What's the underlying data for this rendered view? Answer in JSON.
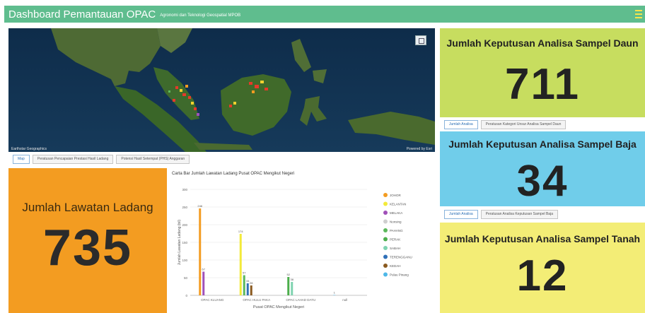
{
  "header": {
    "title": "Dashboard Pemantauan OPAC",
    "subtitle": "Agronomi dan Teknologi Geospatial MPOB"
  },
  "map": {
    "attribution": "Earthstar Geographics",
    "powered_by": "Powered by Esri",
    "tabs": [
      {
        "label": "Map",
        "active": true
      },
      {
        "label": "Peratusan Pencapaian Prestasi Hasil Ladang",
        "active": false
      },
      {
        "label": "Potensi Hasil Setempat (PHS) Anggaran",
        "active": false
      }
    ]
  },
  "kpi_lawatan": {
    "title": "Jumlah Lawatan Ladang",
    "value": "735",
    "color": "#f39c21"
  },
  "kpi_daun": {
    "title": "Jumlah Keputusan Analisa Sampel Daun",
    "value": "711",
    "color": "#c7dd5f",
    "tabs": [
      {
        "label": "Jumlah Analisa",
        "active": true
      },
      {
        "label": "Peratusan Kategori Unsur Analisa Sampel Daun",
        "active": false
      }
    ]
  },
  "kpi_baja": {
    "title": "Jumlah Keputusan Analisa Sampel Baja",
    "value": "34",
    "color": "#70cdea",
    "tabs": [
      {
        "label": "Jumlah Analisa",
        "active": true
      },
      {
        "label": "Peratusan Analisa Keputusan Sampel Baja",
        "active": false
      }
    ]
  },
  "kpi_tanah": {
    "title": "Jumlah Keputusan Analisa Sampel Tanah",
    "value": "12",
    "color": "#f3ed76"
  },
  "chart_data": {
    "type": "bar",
    "title": "Carta Bar Jumlah Lawatan Ladang Pusat OPAC Mengikut Negeri",
    "xlabel": "Pusat OPAC Mengikut Negeri",
    "ylabel": "Jumlah Lawatan Ladang (bil)",
    "ylim": [
      0,
      300
    ],
    "yticks": [
      0,
      50,
      100,
      150,
      200,
      250,
      300
    ],
    "categories": [
      "OPAC KLUANG",
      "OPAC HULU PAKA",
      "OPAC LAHAD DATU",
      "null"
    ],
    "series": [
      {
        "name": "JOHOR",
        "color": "#f39c21",
        "values": [
          246,
          0,
          0,
          0
        ]
      },
      {
        "name": "KELANTAN",
        "color": "#f3ea3a",
        "values": [
          0,
          174,
          0,
          0
        ]
      },
      {
        "name": "MELAKA",
        "color": "#a050b8",
        "values": [
          67,
          0,
          0,
          0
        ]
      },
      {
        "name": "Nonsing",
        "color": "#cfcfcf",
        "values": [
          0,
          0,
          0,
          0
        ]
      },
      {
        "name": "PAHANG",
        "color": "#5cb85c",
        "values": [
          0,
          57,
          0,
          0
        ]
      },
      {
        "name": "PERAK",
        "color": "#4cae4c",
        "values": [
          0,
          0,
          52,
          0
        ]
      },
      {
        "name": "SABAH",
        "color": "#7fd3b0",
        "values": [
          0,
          0,
          38,
          0
        ]
      },
      {
        "name": "TERENGGANU",
        "color": "#3070b8",
        "values": [
          0,
          34,
          0,
          0
        ]
      },
      {
        "name": "KEDAH",
        "color": "#8a5a20",
        "values": [
          0,
          28,
          0,
          0
        ]
      },
      {
        "name": "Pulau Pinang",
        "color": "#4fb8e8",
        "values": [
          0,
          0,
          0,
          1
        ]
      }
    ],
    "data_labels": [
      "246",
      "67",
      "174",
      "57",
      "34",
      "28",
      "52",
      "38",
      "1"
    ],
    "grid": true,
    "legend": "right"
  }
}
